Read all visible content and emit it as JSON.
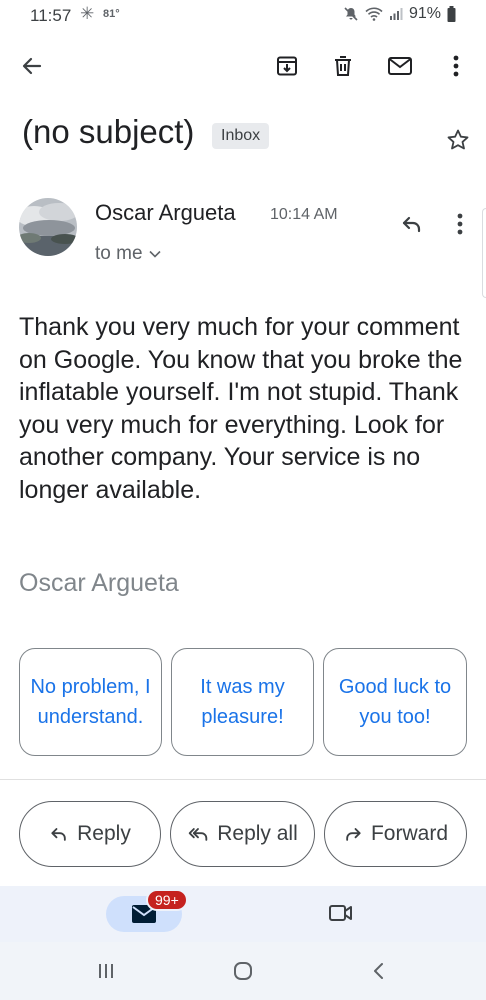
{
  "status_bar": {
    "time": "11:57",
    "temperature": "81°",
    "battery": "91%"
  },
  "app_bar": {
    "icons": [
      "back-arrow-icon",
      "archive-icon",
      "delete-icon",
      "mark-unread-icon",
      "more-vert-icon"
    ]
  },
  "email": {
    "subject": "(no subject)",
    "label": "Inbox",
    "sender_name": "Oscar Argueta",
    "time": "10:14 AM",
    "recipient": "to me",
    "body": "Thank you very much for your comment on Google. You know that you broke the inflatable yourself. I'm not stupid. Thank you very much for everything. Look for another company. Your service is no longer available.",
    "signature": "Oscar Argueta"
  },
  "smart_replies": [
    "No problem, I understand.",
    "It was my pleasure!",
    "Good luck to you too!"
  ],
  "actions": {
    "reply": "Reply",
    "reply_all": "Reply all",
    "forward": "Forward"
  },
  "bottom_nav": {
    "mail_badge": "99+"
  },
  "colors": {
    "accent": "#1a73e8",
    "badge": "#c5221f",
    "nav_bg": "#eef2fa",
    "pill": "#cfe0fc"
  }
}
